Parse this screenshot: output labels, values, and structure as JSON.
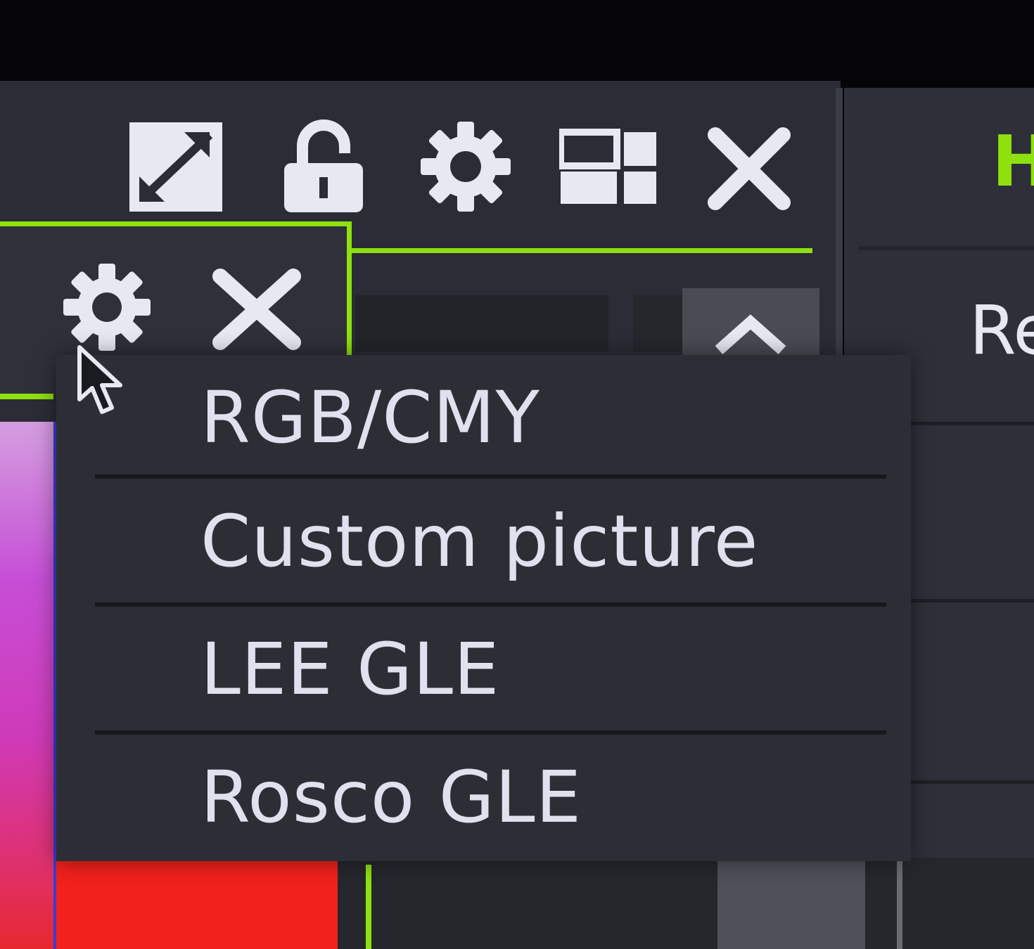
{
  "toolbar": {
    "icons": [
      "expand-icon",
      "unlock-icon",
      "gear-icon",
      "layout-icon",
      "close-icon"
    ]
  },
  "right_panel": {
    "header_fragment": "H",
    "label_fragment": "Re"
  },
  "sub_toolbar": {
    "icons": [
      "gear-icon",
      "close-icon"
    ]
  },
  "scroll_up_icon": "chevron-up-icon",
  "menu": {
    "items": [
      {
        "label": "RGB/CMY"
      },
      {
        "label": "Custom picture"
      },
      {
        "label": "LEE GLE"
      },
      {
        "label": "Rosco GLE"
      }
    ]
  },
  "colors": {
    "accent": "#8ee10f",
    "panel_bg": "#2b2c35",
    "menu_bg": "#2d2e35",
    "text": "#dfe2ee",
    "swatch_red": "#f2211c",
    "swatch_magenta": "#c64ed6"
  }
}
